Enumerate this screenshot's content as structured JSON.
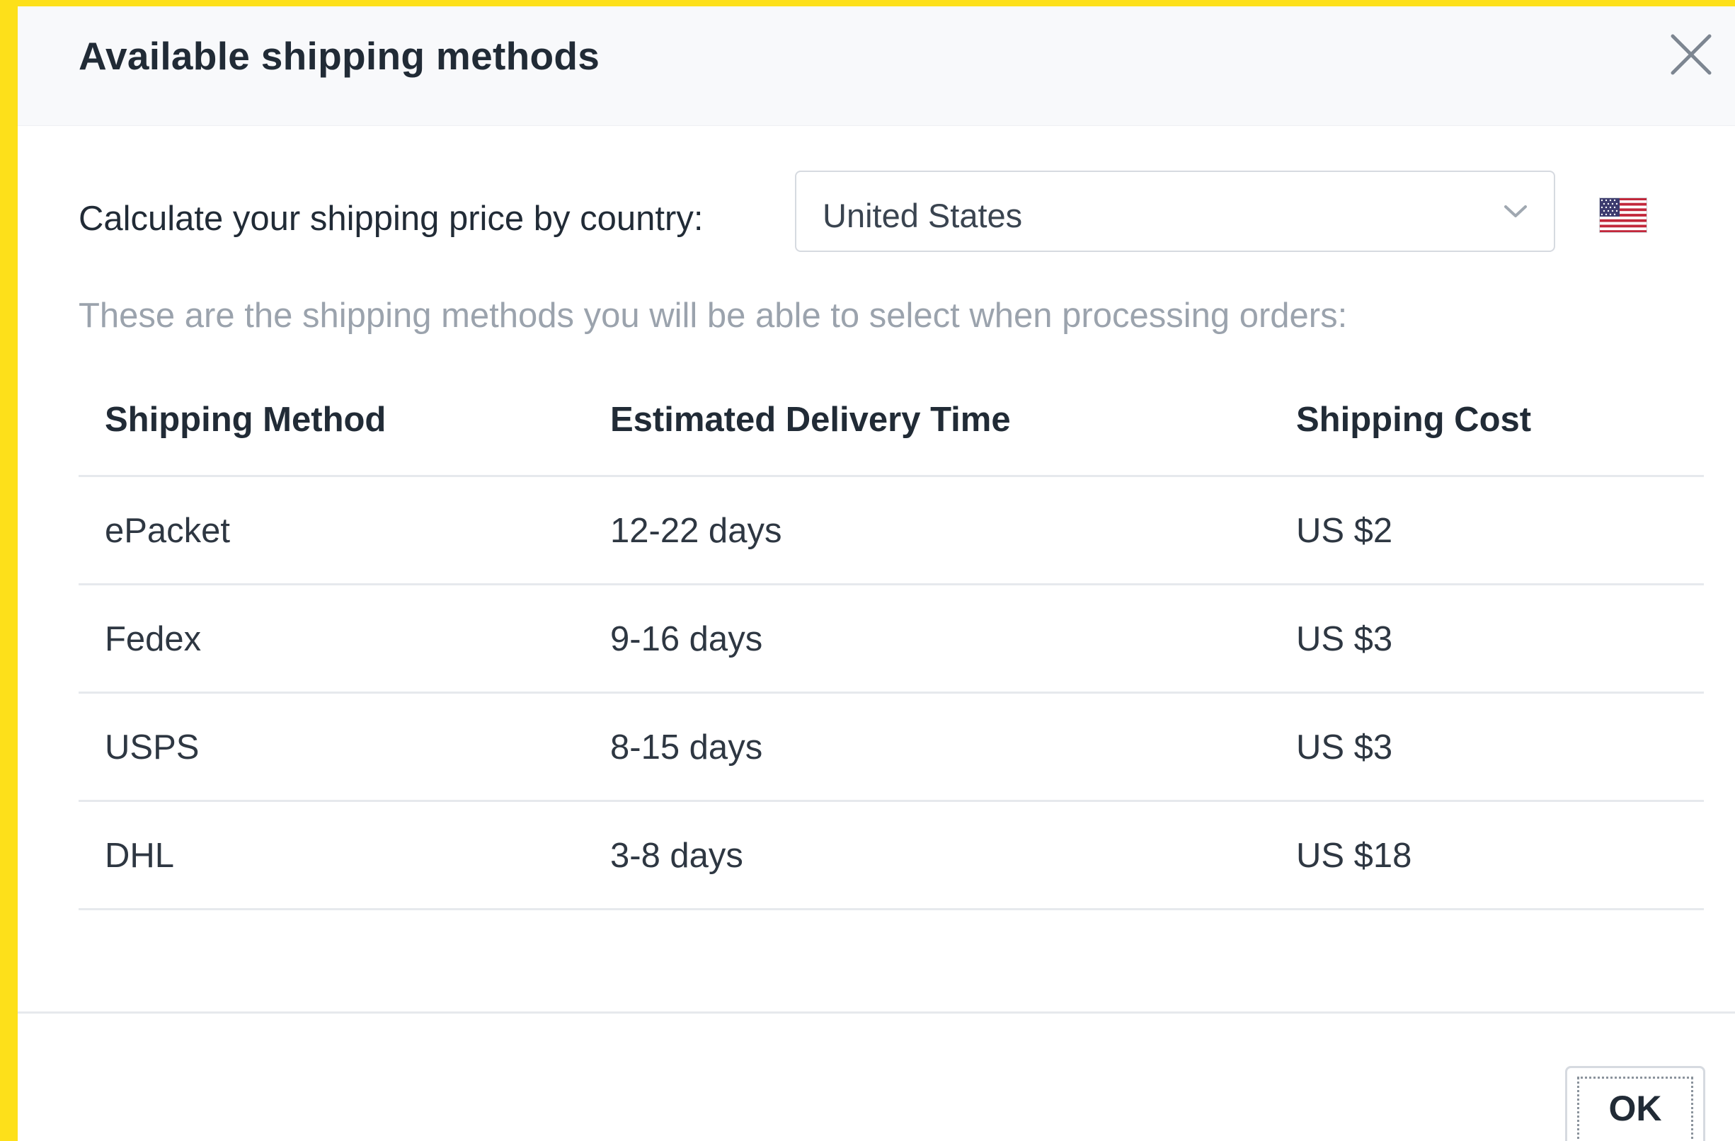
{
  "dialog": {
    "title": "Available shipping methods",
    "close_icon": "close-icon"
  },
  "country": {
    "label": "Calculate your shipping price by country:",
    "selected": "United States",
    "flag_icon": "us-flag-icon"
  },
  "info_text": "These are the shipping methods you will be able to select when processing orders:",
  "table": {
    "headers": [
      "Shipping Method",
      "Estimated Delivery Time",
      "Shipping Cost"
    ],
    "rows": [
      [
        "ePacket",
        "12-22 days",
        "US $2"
      ],
      [
        "Fedex",
        "9-16 days",
        "US $3"
      ],
      [
        "USPS",
        "8-15 days",
        "US $3"
      ],
      [
        "DHL",
        "3-8 days",
        "US $18"
      ]
    ]
  },
  "footer": {
    "ok_label": "OK"
  },
  "colors": {
    "background_frame": "#fde01a",
    "header_bg": "#f8f9fb",
    "text_primary": "#212b36",
    "text_muted": "#9ba3ad",
    "divider": "#e6e9ed"
  }
}
